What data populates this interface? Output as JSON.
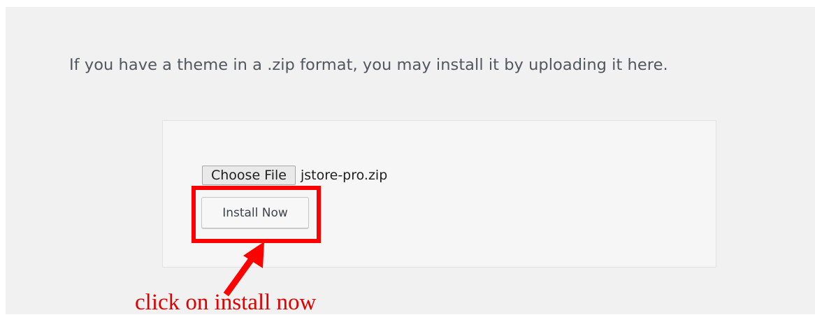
{
  "upload": {
    "description": "If you have a theme in a .zip format, you may install it by uploading it here.",
    "choose_file_label": "Choose File",
    "file_name": "jstore-pro.zip",
    "install_label": "Install Now"
  },
  "annotation": {
    "text": "click on install now",
    "color": "#ff0000"
  }
}
